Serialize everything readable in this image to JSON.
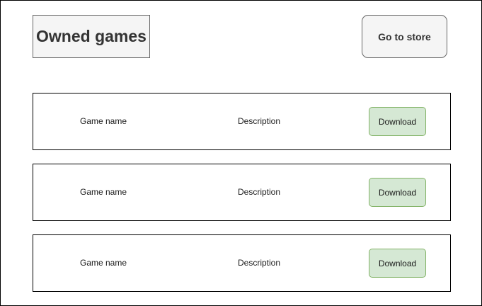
{
  "header": {
    "title": "Owned games",
    "store_button_label": "Go to store"
  },
  "games": [
    {
      "name": "Game name",
      "description": "Description",
      "action_label": "Download"
    },
    {
      "name": "Game name",
      "description": "Description",
      "action_label": "Download"
    },
    {
      "name": "Game name",
      "description": "Description",
      "action_label": "Download"
    }
  ],
  "colors": {
    "title_background": "#f5f5f5",
    "title_text": "#333333",
    "download_background": "#d5e8d4",
    "download_border": "#82b366"
  }
}
